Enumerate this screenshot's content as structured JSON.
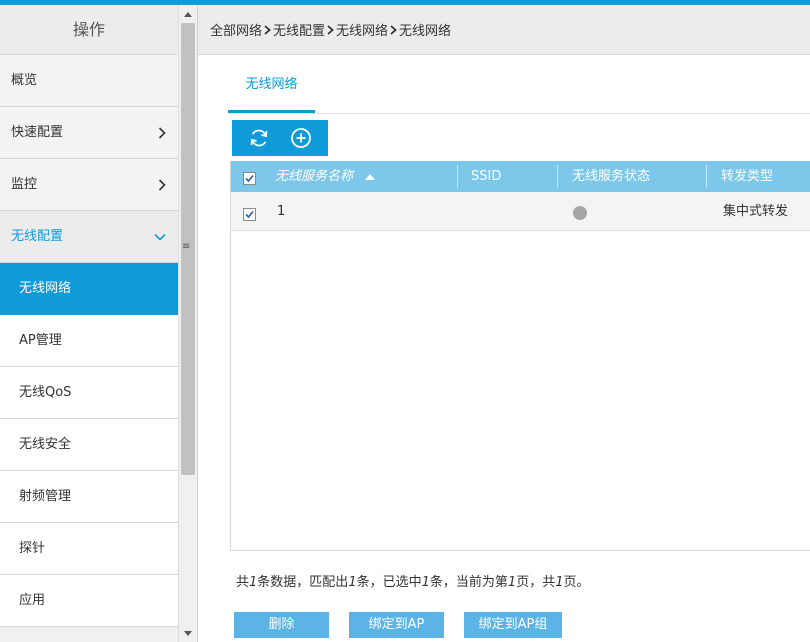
{
  "sidebar": {
    "header": "操作",
    "items": [
      {
        "label": "概览"
      },
      {
        "label": "快速配置"
      },
      {
        "label": "监控"
      },
      {
        "label": "无线配置"
      }
    ],
    "subitems": [
      {
        "label": "无线网络"
      },
      {
        "label": "AP管理"
      },
      {
        "label": "无线QoS"
      },
      {
        "label": "无线安全"
      },
      {
        "label": "射频管理"
      },
      {
        "label": "探针"
      },
      {
        "label": "应用"
      }
    ]
  },
  "breadcrumb": [
    "全部网络",
    "无线配置",
    "无线网络",
    "无线网络"
  ],
  "tabs": [
    {
      "label": "无线网络"
    }
  ],
  "table": {
    "columns": [
      "无线服务名称",
      "SSID",
      "无线服务状态",
      "转发类型"
    ],
    "rows": [
      {
        "name": "1",
        "ssid": "",
        "status": "inactive",
        "forward_type": "集中式转发"
      }
    ]
  },
  "summary": {
    "p1": "共",
    "total": "1",
    "p2": "条数据，匹配出",
    "matched": "1",
    "p3": "条，已选中",
    "selected": "1",
    "p4": "条，当前为第",
    "page": "1",
    "p5": "页，共",
    "pages": "1",
    "p6": "页。"
  },
  "buttons": {
    "delete": "删除",
    "bind_ap": "绑定到AP",
    "bind_ap_group": "绑定到AP组"
  },
  "colors": {
    "accent": "#0e9bd8",
    "header_row": "#7cc7ea",
    "button": "#5cb4e6"
  }
}
